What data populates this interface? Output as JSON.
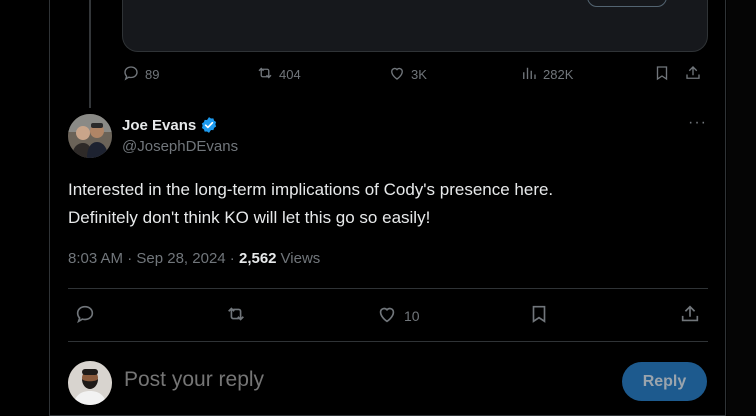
{
  "top_actions": {
    "replies": "89",
    "reposts": "404",
    "likes": "3K",
    "views": "282K"
  },
  "tweet": {
    "author_name": "Joe Evans",
    "handle": "@JosephDEvans",
    "more": "···",
    "text_line1": "Interested in the long-term implications of Cody's presence here.",
    "text_line2": "Definitely don't think KO will let this go so easily!",
    "time": "8:03 AM",
    "separator": " · ",
    "date": "Sep 28, 2024",
    "views_count": "2,562",
    "views_label": "Views"
  },
  "actions": {
    "likes": "10"
  },
  "reply_box": {
    "placeholder": "Post your reply",
    "button_label": "Reply"
  },
  "colors": {
    "background": "#000000",
    "text_primary": "#e7e9ea",
    "text_secondary": "#71767b",
    "accent": "#1d9bf0",
    "reply_button_disabled": "#1d5a8e"
  }
}
